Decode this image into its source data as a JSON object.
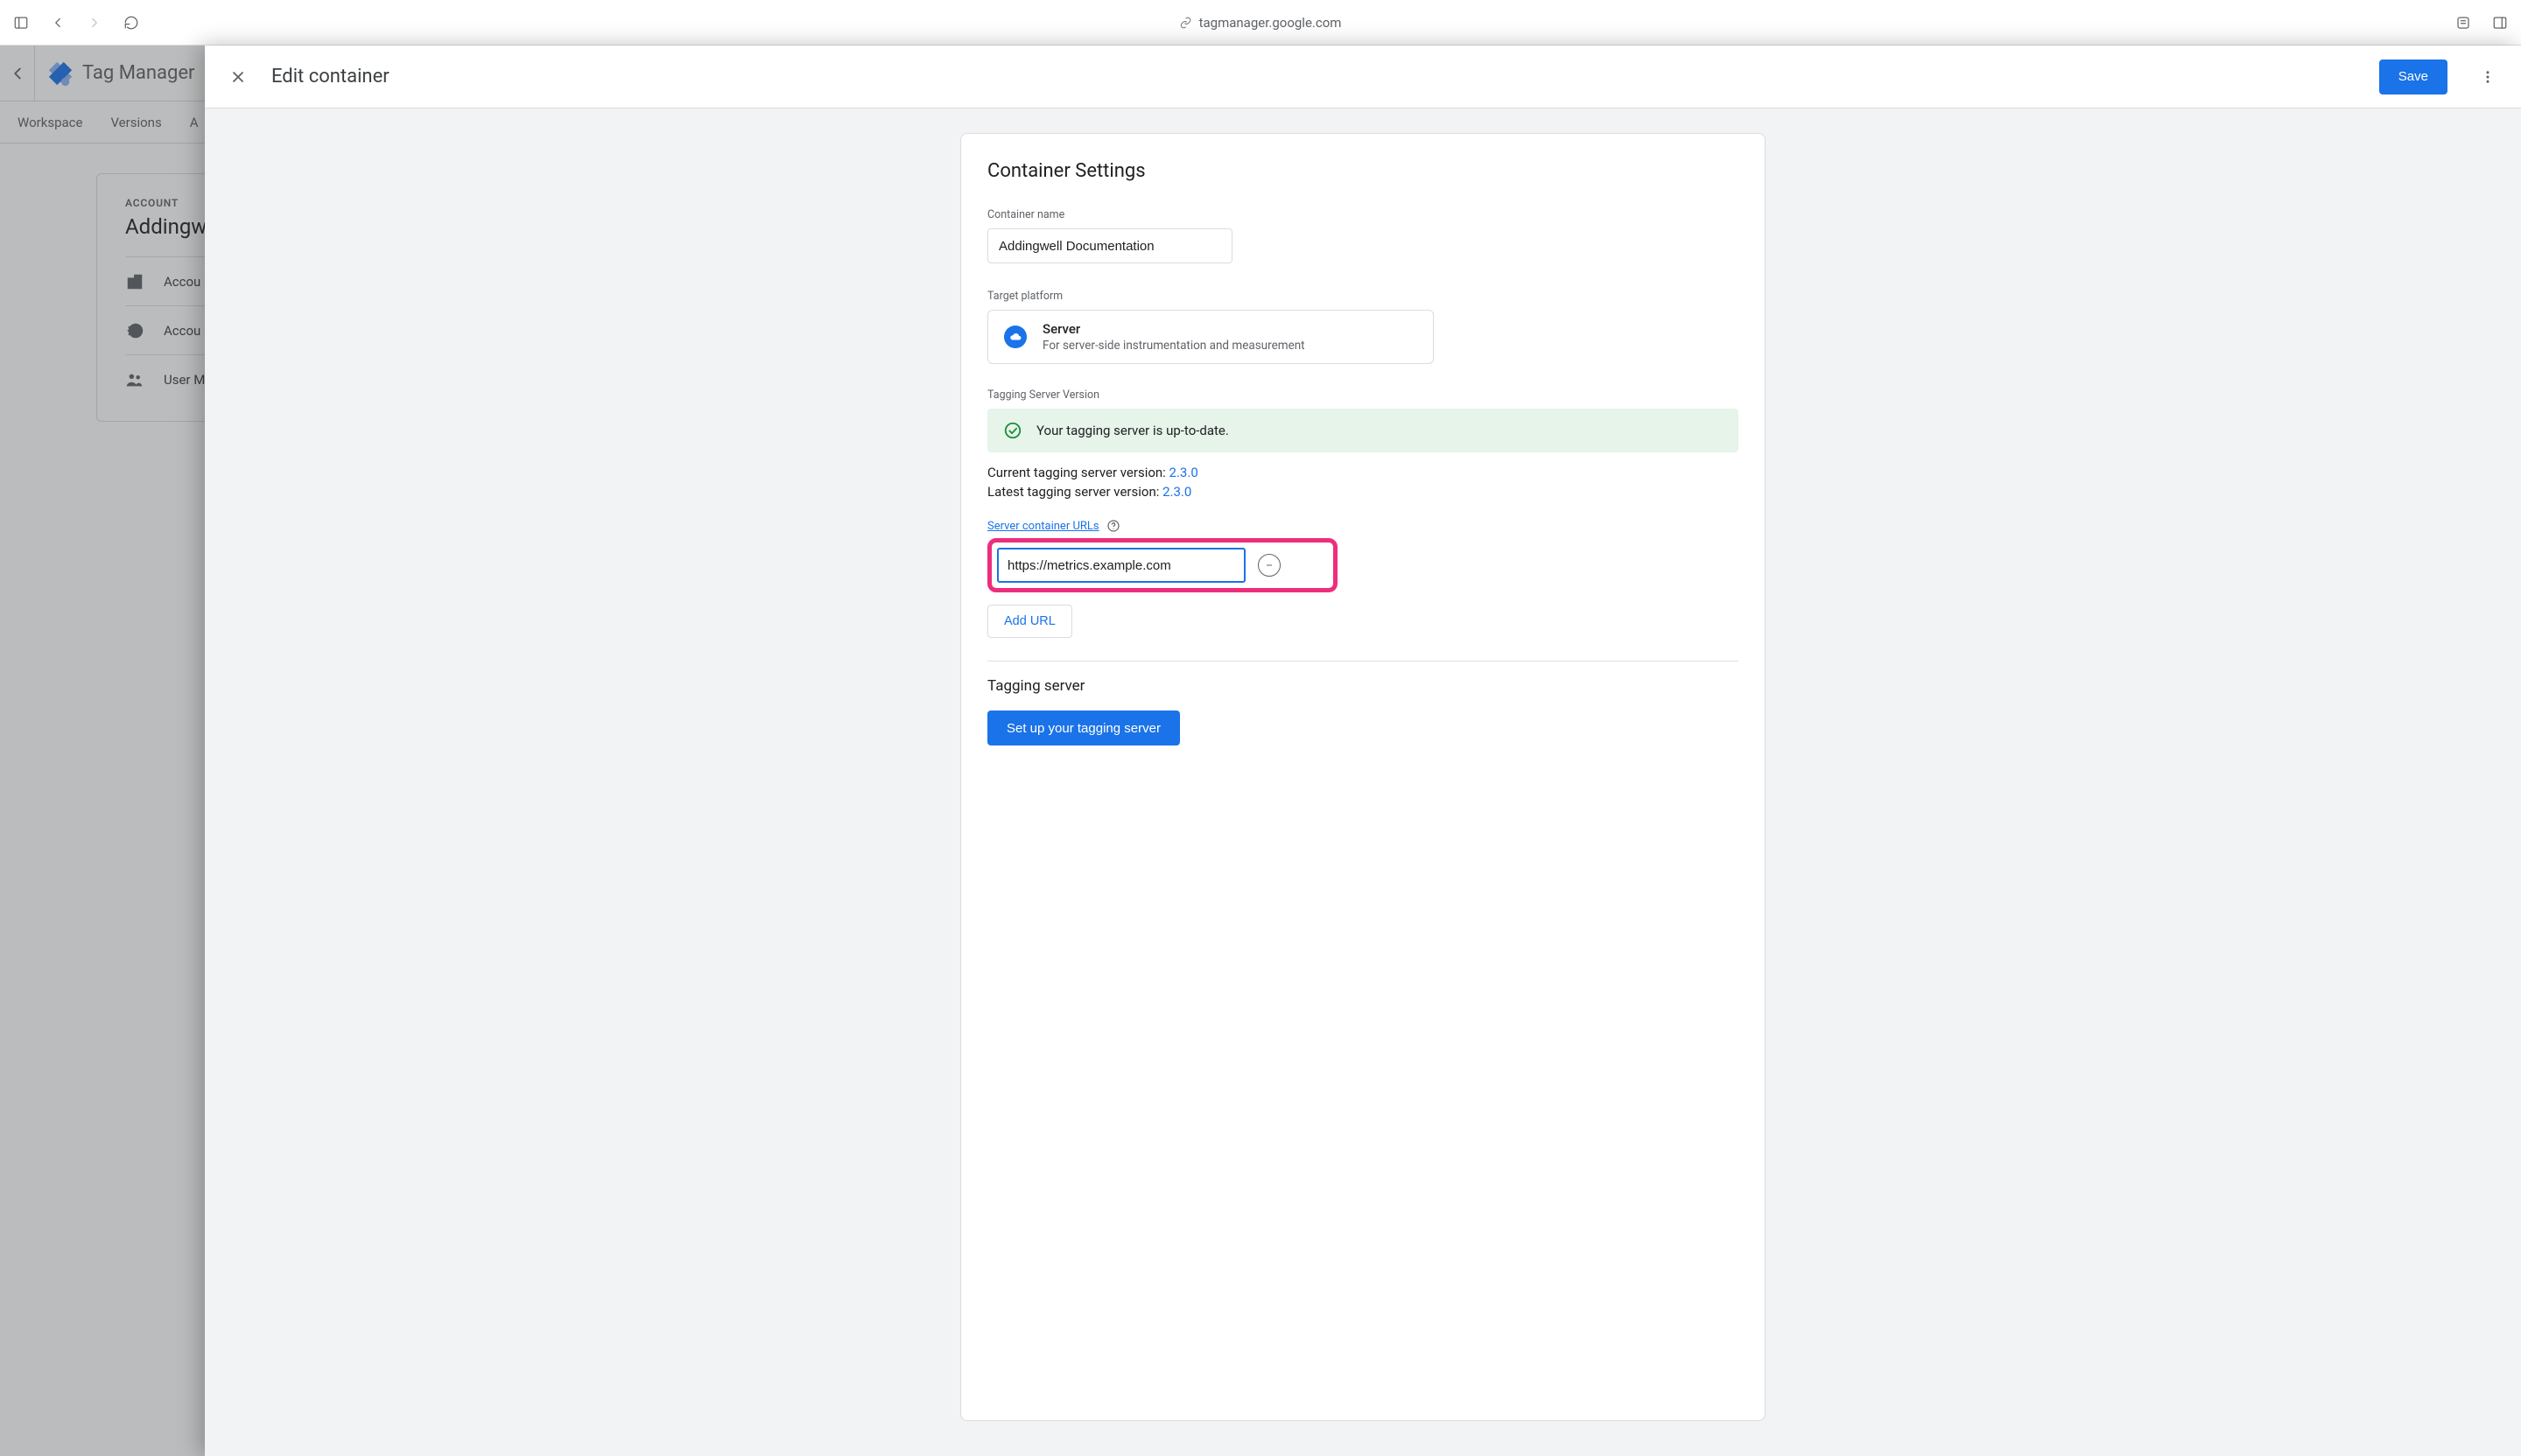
{
  "browser": {
    "url": "tagmanager.google.com"
  },
  "gtm": {
    "title": "Tag Manager",
    "tabs": [
      "Workspace",
      "Versions",
      "A"
    ],
    "bg": {
      "account_label": "ACCOUNT",
      "account_name": "Addingwe",
      "rows": [
        "Accou",
        "Accou",
        "User M"
      ]
    }
  },
  "panel": {
    "title": "Edit container",
    "save": "Save"
  },
  "settings": {
    "heading": "Container Settings",
    "name_label": "Container name",
    "name_value": "Addingwell Documentation",
    "platform_label": "Target platform",
    "platform_title": "Server",
    "platform_sub": "For server-side instrumentation and measurement",
    "version_label": "Tagging Server Version",
    "version_banner": "Your tagging server is up-to-date.",
    "current_prefix": "Current tagging server version: ",
    "current_ver": "2.3.0",
    "latest_prefix": "Latest tagging server version: ",
    "latest_ver": "2.3.0",
    "urls_label": "Server container URLs",
    "url_value": "https://metrics.example.com",
    "add_url": "Add URL",
    "tagging_server_heading": "Tagging server",
    "setup_btn": "Set up your tagging server"
  }
}
